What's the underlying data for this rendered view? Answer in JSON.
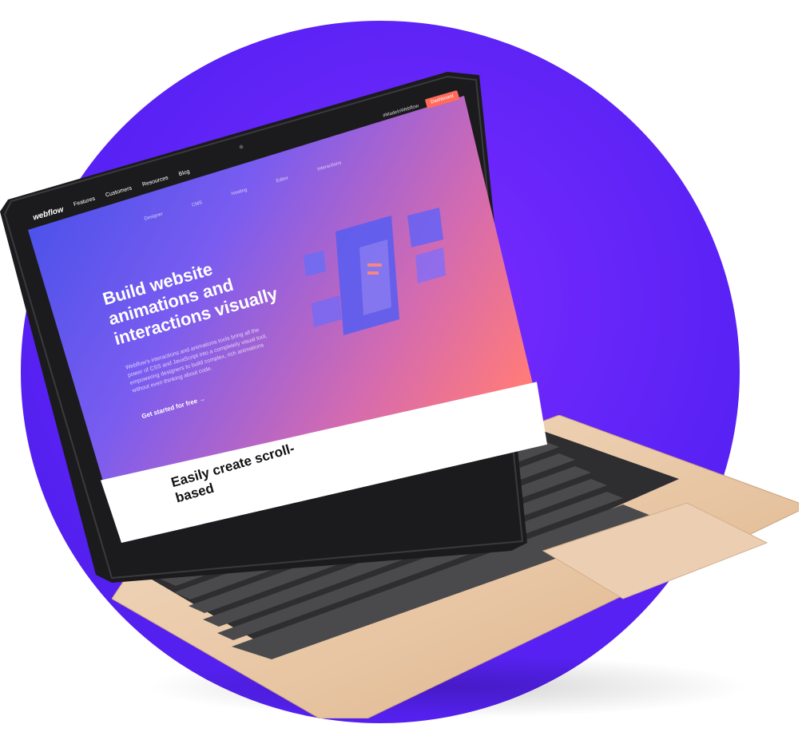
{
  "screen": {
    "nav": {
      "logo": "webflow",
      "items": [
        "Features",
        "Customers",
        "Resources",
        "Blog"
      ]
    },
    "subnav": [
      "Designer",
      "CMS",
      "Hosting",
      "Editor",
      "Interactions"
    ],
    "top_right": {
      "link": "#MadeInWebflow",
      "button": "Dashboard"
    },
    "hero": {
      "title_lines": [
        "Build website",
        "animations and",
        "interactions visually"
      ],
      "description": "Webflow's interactions and animations tools bring all the power of CSS and JavaScript into a completely visual tool, empowering designers to build complex, rich animations without even thinking about code.",
      "cta": "Get started for free"
    },
    "section_title": "Easily create scroll-based"
  },
  "colors": {
    "background_circle": "#5a22f5",
    "gradient_start": "#3b4ee8",
    "gradient_end": "#ff7a7a",
    "laptop_gold": "#e9c9a8",
    "key_color": "#3a3a3c"
  }
}
